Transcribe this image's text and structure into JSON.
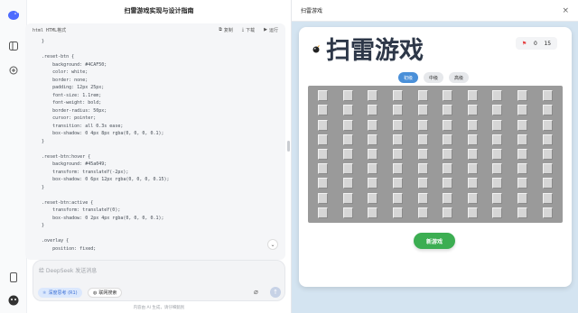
{
  "chat": {
    "title": "扫雷游戏实现与设计指南",
    "code_lang": "html HTML格式",
    "copy_label": "复制",
    "download_label": "下载",
    "run_label": "运行",
    "code_lines": [
      "    }",
      "",
      "    .reset-btn {",
      "        background: #4CAF50;",
      "        color: white;",
      "        border: none;",
      "        padding: 12px 25px;",
      "        font-size: 1.1rem;",
      "        font-weight: bold;",
      "        border-radius: 50px;",
      "        cursor: pointer;",
      "        transition: all 0.3s ease;",
      "        box-shadow: 0 4px 8px rgba(0, 0, 0, 0.1);",
      "    }",
      "",
      "    .reset-btn:hover {",
      "        background: #45a049;",
      "        transform: translateY(-2px);",
      "        box-shadow: 0 6px 12px rgba(0, 0, 0, 0.15);",
      "    }",
      "",
      "    .reset-btn:active {",
      "        transform: translateY(0);",
      "        box-shadow: 0 2px 4px rgba(0, 0, 0, 0.1);",
      "    }",
      "",
      "    .overlay {",
      "        position: fixed;"
    ],
    "input_placeholder": "给 DeepSeek 发送消息",
    "think_chip": "深度思考 (R1)",
    "web_chip": "联网搜索",
    "disclaimer": "内容由 AI 生成，请仔细甄别"
  },
  "preview": {
    "bar_title": "扫雷游戏",
    "game_title": "扫雷游戏",
    "mines_left": "0",
    "timer": "15",
    "levels": [
      "初级",
      "中级",
      "高级"
    ],
    "active_level": 0,
    "board_rows": 9,
    "board_cols": 10,
    "new_game_label": "新游戏"
  },
  "colors": {
    "new_game": "#3cae52",
    "active_level": "#4a90d9",
    "board_bg": "#9a9a9a",
    "preview_bg": "#d4e4f1"
  },
  "icons": {
    "rail": [
      "deepseek-logo-icon",
      "sidebar-toggle-icon",
      "new-chat-icon",
      "phone-icon",
      "user-avatar-icon"
    ],
    "game": "bomb-icon"
  }
}
